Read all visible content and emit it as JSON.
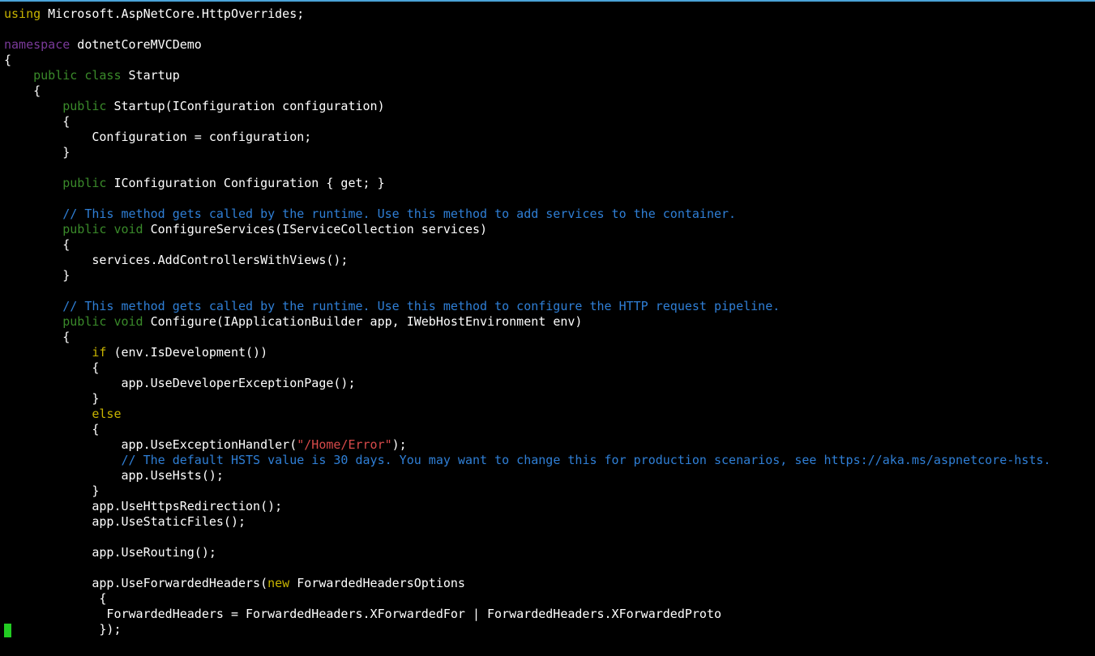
{
  "editor": {
    "cursor_line": 41,
    "lines": [
      [
        {
          "t": "using",
          "c": "kw-yellow"
        },
        {
          "t": " Microsoft.AspNetCore.HttpOverrides;"
        }
      ],
      [],
      [
        {
          "t": "namespace",
          "c": "kw-namespace"
        },
        {
          "t": " dotnetCoreMVCDemo"
        }
      ],
      [
        {
          "t": "{"
        }
      ],
      [
        {
          "t": "    "
        },
        {
          "t": "public",
          "c": "kw-green"
        },
        {
          "t": " "
        },
        {
          "t": "class",
          "c": "kw-green"
        },
        {
          "t": " Startup"
        }
      ],
      [
        {
          "t": "    {"
        }
      ],
      [
        {
          "t": "        "
        },
        {
          "t": "public",
          "c": "kw-green"
        },
        {
          "t": " Startup(IConfiguration configuration)"
        }
      ],
      [
        {
          "t": "        {"
        }
      ],
      [
        {
          "t": "            Configuration = configuration;"
        }
      ],
      [
        {
          "t": "        }"
        }
      ],
      [],
      [
        {
          "t": "        "
        },
        {
          "t": "public",
          "c": "kw-green"
        },
        {
          "t": " IConfiguration Configuration { get; }"
        }
      ],
      [],
      [
        {
          "t": "        "
        },
        {
          "t": "// This method gets called by the runtime. Use this method to add services to the container.",
          "c": "comment"
        }
      ],
      [
        {
          "t": "        "
        },
        {
          "t": "public",
          "c": "kw-green"
        },
        {
          "t": " "
        },
        {
          "t": "void",
          "c": "kw-green"
        },
        {
          "t": " ConfigureServices(IServiceCollection services)"
        }
      ],
      [
        {
          "t": "        {"
        }
      ],
      [
        {
          "t": "            services.AddControllersWithViews();"
        }
      ],
      [
        {
          "t": "        }"
        }
      ],
      [],
      [
        {
          "t": "        "
        },
        {
          "t": "// This method gets called by the runtime. Use this method to configure the HTTP request pipeline.",
          "c": "comment"
        }
      ],
      [
        {
          "t": "        "
        },
        {
          "t": "public",
          "c": "kw-green"
        },
        {
          "t": " "
        },
        {
          "t": "void",
          "c": "kw-green"
        },
        {
          "t": " Configure(IApplicationBuilder app, IWebHostEnvironment env)"
        }
      ],
      [
        {
          "t": "        {"
        }
      ],
      [
        {
          "t": "            "
        },
        {
          "t": "if",
          "c": "kw-yellow"
        },
        {
          "t": " (env.IsDevelopment())"
        }
      ],
      [
        {
          "t": "            {"
        }
      ],
      [
        {
          "t": "                app.UseDeveloperExceptionPage();"
        }
      ],
      [
        {
          "t": "            }"
        }
      ],
      [
        {
          "t": "            "
        },
        {
          "t": "else",
          "c": "kw-yellow"
        }
      ],
      [
        {
          "t": "            {"
        }
      ],
      [
        {
          "t": "                app.UseExceptionHandler("
        },
        {
          "t": "\"/Home/Error\"",
          "c": "string"
        },
        {
          "t": ");"
        }
      ],
      [
        {
          "t": "                "
        },
        {
          "t": "// The default HSTS value is 30 days. You may want to change this for production scenarios, see https://aka.ms/aspnetcore-hsts.",
          "c": "comment"
        }
      ],
      [
        {
          "t": "                app.UseHsts();"
        }
      ],
      [
        {
          "t": "            }"
        }
      ],
      [
        {
          "t": "            app.UseHttpsRedirection();"
        }
      ],
      [
        {
          "t": "            app.UseStaticFiles();"
        }
      ],
      [],
      [
        {
          "t": "            app.UseRouting();"
        }
      ],
      [],
      [
        {
          "t": "            app.UseForwardedHeaders("
        },
        {
          "t": "new",
          "c": "kw-yellow"
        },
        {
          "t": " ForwardedHeadersOptions"
        }
      ],
      [
        {
          "t": "             {"
        }
      ],
      [
        {
          "t": "              ForwardedHeaders = ForwardedHeaders.XForwardedFor | ForwardedHeaders.XForwardedProto"
        }
      ],
      [
        {
          "t": "             });"
        }
      ]
    ]
  }
}
